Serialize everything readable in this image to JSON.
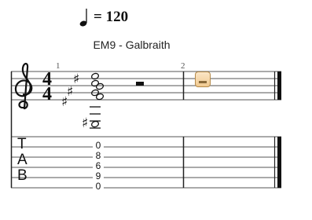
{
  "tempo": {
    "value": "= 120"
  },
  "chord": {
    "label": "EM9 - Galbraith"
  },
  "measures": [
    {
      "number": "1"
    },
    {
      "number": "2"
    }
  ],
  "time_signature": {
    "top": "4",
    "bottom": "4"
  },
  "clef": {
    "name": "treble-clef-icon"
  },
  "tab_clef": {
    "letters": [
      "T",
      "A",
      "B"
    ]
  },
  "tab_frets": [
    "0",
    "8",
    "6",
    "9",
    "0"
  ],
  "colors": {
    "staff": "#555555",
    "ink": "#111111",
    "cursor": "#f0c98f"
  }
}
